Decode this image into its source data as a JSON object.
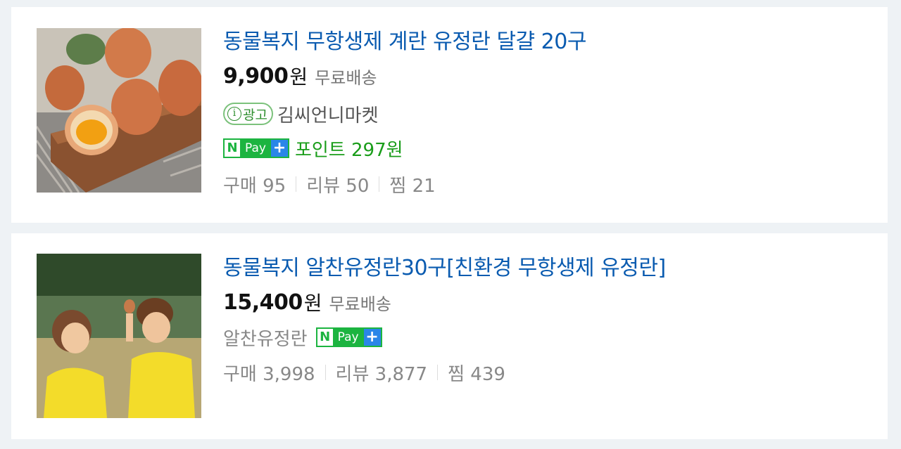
{
  "products": [
    {
      "title": "동물복지 무항생제 계란 유정란 달걀 20구",
      "price": "9,900",
      "currency": "원",
      "shipping": "무료배송",
      "ad_label": "광고",
      "seller": "김씨언니마켓",
      "npay": {
        "n": "N",
        "pay": "Pay",
        "plus": "+"
      },
      "points": "포인트 297원",
      "stats": {
        "purchase": "구매 95",
        "review": "리뷰 50",
        "wish": "찜 21"
      }
    },
    {
      "title": "동물복지 알찬유정란30구[친환경 무항생제 유정란]",
      "price": "15,400",
      "currency": "원",
      "shipping": "무료배송",
      "seller": "알찬유정란",
      "npay": {
        "n": "N",
        "pay": "Pay",
        "plus": "+"
      },
      "stats": {
        "purchase": "구매 3,998",
        "review": "리뷰 3,877",
        "wish": "찜 439"
      }
    }
  ],
  "icons": {
    "ad_info": "info-icon"
  },
  "colors": {
    "title": "#0a5bb0",
    "points": "#1a9d1a",
    "npay_green": "#1cb440",
    "npay_blue": "#2a86e8"
  }
}
